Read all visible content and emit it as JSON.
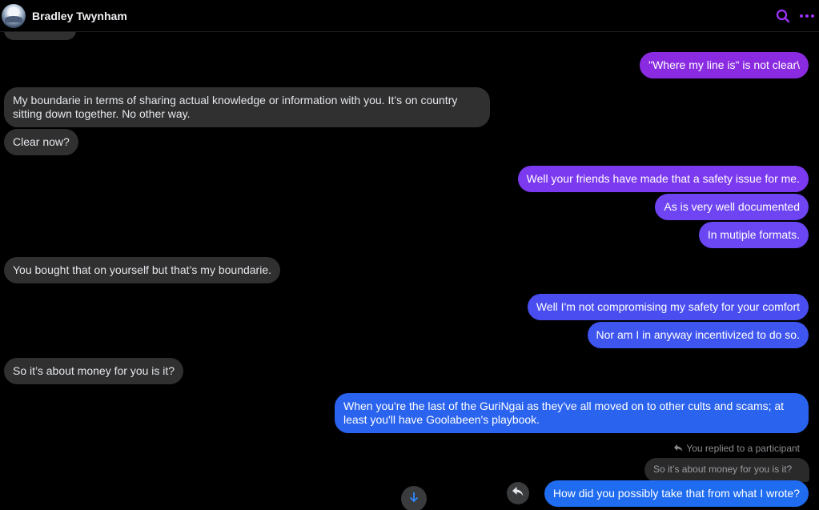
{
  "header": {
    "contact_name": "Bradley Twynham",
    "icons": [
      "search-icon",
      "more-icon"
    ],
    "accent": "#a033ff"
  },
  "messages": [
    {
      "id": "m1",
      "side": "out",
      "text": "\"Where my line is\" is not clear\\"
    },
    {
      "id": "m2",
      "side": "in",
      "text": "My boundarie in terms of sharing actual knowledge or information with you. It’s on country sitting down together. No other way."
    },
    {
      "id": "m3",
      "side": "in",
      "text": "Clear now?"
    },
    {
      "id": "m4",
      "side": "out",
      "text": "Well your friends have made that a safety issue for me."
    },
    {
      "id": "m5",
      "side": "out",
      "text": "As is very well documented"
    },
    {
      "id": "m6",
      "side": "out",
      "text": "In mutiple formats."
    },
    {
      "id": "m7",
      "side": "in",
      "text": "You bought that on yourself but that’s my boundarie."
    },
    {
      "id": "m8",
      "side": "out",
      "text": "Well I'm not compromising my safety for your comfort"
    },
    {
      "id": "m9",
      "side": "out",
      "text": "Nor am I in anyway incentivized to do so."
    },
    {
      "id": "m10",
      "side": "in",
      "text": "So it’s about money for you is it?"
    },
    {
      "id": "m11",
      "side": "out",
      "text": "When you're the last of the GuriNgai as they've all moved on to other cults and scams; at least you'll have Goolabeen's playbook."
    },
    {
      "id": "m12",
      "side": "out",
      "text": "How did you possibly take that from what I wrote?"
    }
  ],
  "reply": {
    "meta": "You replied to a participant",
    "quoted": "So it’s about money for you is it?"
  },
  "colors": {
    "incoming": "#303030",
    "outgoing_purple": "#8a2be2",
    "outgoing_blue": "#2f5ee8"
  }
}
